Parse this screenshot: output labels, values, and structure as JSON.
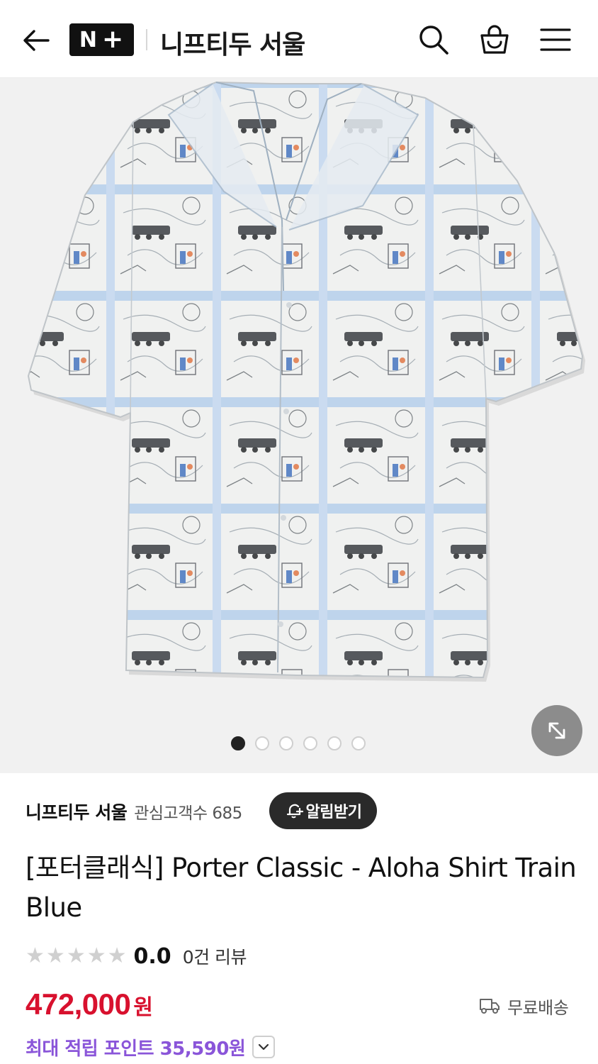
{
  "header": {
    "back_icon": "arrow-left-icon",
    "logo_text": "N",
    "logo_plus": "+",
    "title": "니프티두 서울",
    "search_icon": "search-icon",
    "bag_icon": "shopping-bag-icon",
    "menu_icon": "hamburger-menu-icon"
  },
  "gallery": {
    "image_subject": "Aloha shirt with train print pattern",
    "total_images": 6,
    "active_index": 0,
    "expand_icon": "expand-icon"
  },
  "store": {
    "name": "니프티두 서울",
    "followers": "관심고객수 685",
    "alarm_label": "알림받기",
    "alarm_icon": "bell-plus-icon"
  },
  "product": {
    "title": "[포터클래식] Porter Classic - Aloha Shirt Train Blue",
    "rating": "0.0",
    "rating_stars": 0,
    "review_count": "0건 리뷰",
    "price": "472,000",
    "currency": "원",
    "shipping": "무료배송",
    "shipping_icon": "delivery-truck-icon",
    "points": "최대 적립 포인트 35,590원",
    "points_toggle_icon": "chevron-down-icon"
  },
  "colors": {
    "price": "#d8112e",
    "points": "#8a55d9",
    "shirt_blue": "#a9c6e6",
    "shirt_base": "#eef0ee"
  }
}
